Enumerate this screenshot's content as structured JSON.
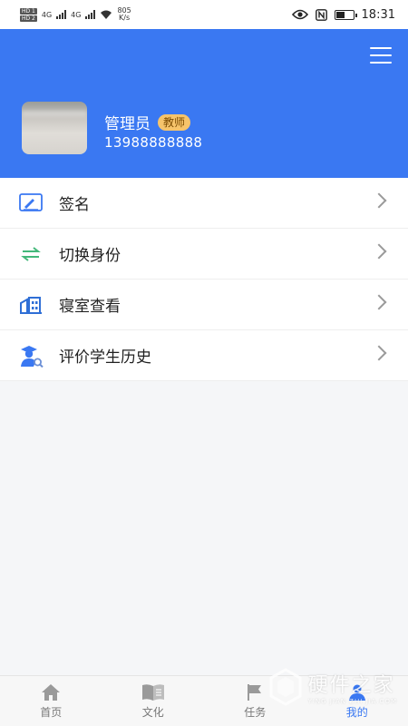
{
  "status_bar": {
    "hd1": "HD 1",
    "hd2": "HD 2",
    "net1": "4G",
    "net2": "4G",
    "speed": "805",
    "speed_unit": "K/s",
    "time": "18:31"
  },
  "header": {
    "name": "管理员",
    "role_badge": "教师",
    "phone": "13988888888",
    "accent_color": "#3a78f2"
  },
  "menu": {
    "items": [
      {
        "label": "签名",
        "icon": "signature-icon"
      },
      {
        "label": "切换身份",
        "icon": "switch-arrows-icon"
      },
      {
        "label": "寝室查看",
        "icon": "dormitory-icon"
      },
      {
        "label": "评价学生历史",
        "icon": "teacher-search-icon"
      }
    ]
  },
  "tabbar": {
    "tabs": [
      {
        "label": "首页",
        "icon": "home-icon"
      },
      {
        "label": "文化",
        "icon": "book-icon"
      },
      {
        "label": "任务",
        "icon": "flag-icon"
      },
      {
        "label": "我的",
        "icon": "user-icon",
        "active": true
      }
    ]
  },
  "watermark": {
    "title": "硬件之家",
    "sub": "YING JIAN ZHI JIA.COM"
  }
}
